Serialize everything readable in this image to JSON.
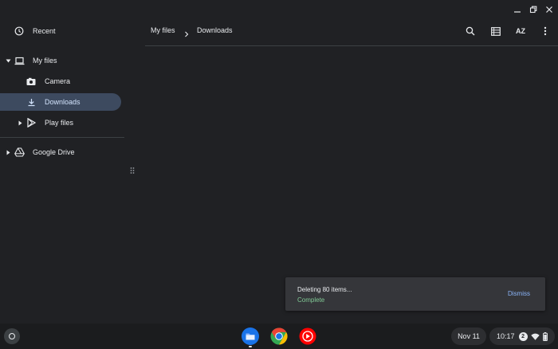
{
  "sidebar": {
    "recent": "Recent",
    "my_files": "My files",
    "camera": "Camera",
    "downloads": "Downloads",
    "play_files": "Play files",
    "google_drive": "Google Drive"
  },
  "breadcrumb": {
    "root": "My files",
    "separator": ">",
    "current": "Downloads"
  },
  "toolbar": {
    "sort_label": "AZ"
  },
  "toast": {
    "title": "Deleting 80 items...",
    "status": "Complete",
    "dismiss": "Dismiss"
  },
  "shelf": {
    "date": "Nov 11",
    "time": "10:17",
    "notification_count": "2"
  },
  "colors": {
    "background": "#202124",
    "active_item": "#3d4a5f",
    "accent_blue": "#8ab4f8",
    "complete_green": "#81c995"
  }
}
